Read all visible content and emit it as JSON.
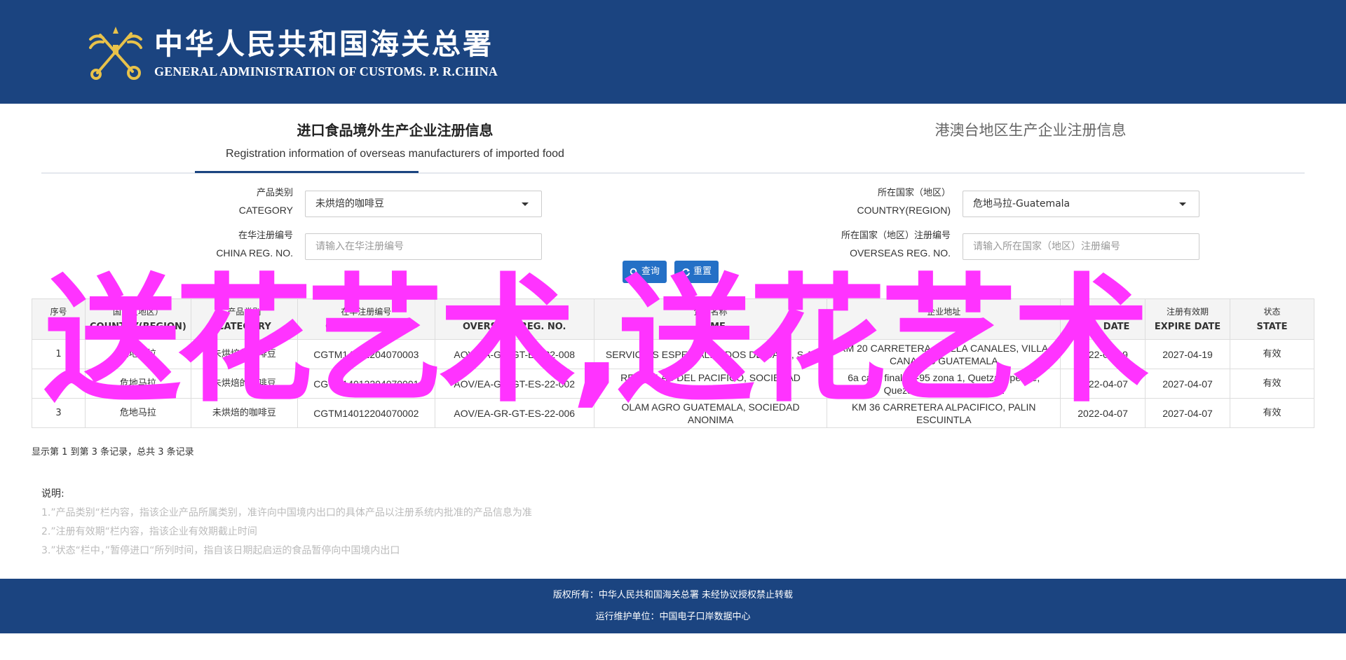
{
  "header": {
    "title_cn": "中华人民共和国海关总署",
    "title_en": "GENERAL ADMINISTRATION OF CUSTOMS. P. R.CHINA"
  },
  "tabs": [
    {
      "label_cn": "进口食品境外生产企业注册信息",
      "label_en": "Registration information of overseas manufacturers of imported food",
      "active": true
    },
    {
      "label_cn": "港澳台地区生产企业注册信息",
      "active": false
    }
  ],
  "form": {
    "category": {
      "label_cn": "产品类别",
      "label_en": "CATEGORY",
      "value": "未烘焙的咖啡豆"
    },
    "country": {
      "label_cn": "所在国家（地区）",
      "label_en": "COUNTRY(REGION)",
      "value": "危地马拉-Guatemala"
    },
    "china_reg": {
      "label_cn": "在华注册编号",
      "label_en": "CHINA REG. NO.",
      "placeholder": "请输入在华注册编号"
    },
    "overseas_reg": {
      "label_cn": "所在国家（地区）注册编号",
      "label_en": "OVERSEAS REG. NO.",
      "placeholder": "请输入所在国家（地区）注册编号"
    },
    "search_label": "查询",
    "reset_label": "重置"
  },
  "table": {
    "columns": [
      {
        "cn": "序号",
        "en": "NO."
      },
      {
        "cn": "国家（地区）",
        "en": "COUNTRY(REGION)"
      },
      {
        "cn": "产品类别",
        "en": "CATEGORY"
      },
      {
        "cn": "在华注册编号",
        "en": "CHINA REG. NO."
      },
      {
        "cn": "所在国家（地区）注册编号",
        "en": "OVERSEAS REG. NO."
      },
      {
        "cn": "企业名称",
        "en": "NAME"
      },
      {
        "cn": "企业地址",
        "en": "ADDRESS"
      },
      {
        "cn": "注册日期",
        "en": "REG. DATE"
      },
      {
        "cn": "注册有效期",
        "en": "EXPIRE DATE"
      },
      {
        "cn": "状态",
        "en": "STATE"
      }
    ],
    "rows": [
      [
        "1",
        "危地马拉",
        "未烘焙的咖啡豆",
        "CGTM14012204070003",
        "AOV/EA-GR-GT-ES-22-008",
        "SERVICIOS ESPECIALIZADOS DE CAFE, S.A.",
        "KM 20 CARRETERA A VILLA CANALES, VILLA CANALES GUATEMALA",
        "2022-04-19",
        "2027-04-19",
        "有效"
      ],
      [
        "2",
        "危地马拉",
        "未烘焙的咖啡豆",
        "CGTM14012204070001",
        "AOV/EA-GR-GT-ES-22-002",
        "RETRILLAS DEL PACIFICO, SOCIEDAD ANONIMA",
        "6a calle final 25-95 zona 1, Quetzaltepeque, Quezaltenango, Guatemala",
        "2022-04-07",
        "2027-04-07",
        "有效"
      ],
      [
        "3",
        "危地马拉",
        "未烘焙的咖啡豆",
        "CGTM14012204070002",
        "AOV/EA-GR-GT-ES-22-006",
        "OLAM AGRO GUATEMALA, SOCIEDAD ANONIMA",
        "KM 36 CARRETERA ALPACIFICO, PALIN ESCUINTLA",
        "2022-04-07",
        "2027-04-07",
        "有效"
      ]
    ]
  },
  "summary": "显示第 1 到第 3 条记录，总共 3 条记录",
  "notes": {
    "title": "说明:",
    "items": [
      "1.”产品类别“栏内容，指该企业产品所属类别，准许向中国境内出口的具体产品以注册系统内批准的产品信息为准",
      "2.”注册有效期“栏内容，指该企业有效期截止时间",
      "3.”状态“栏中，”暂停进口“所列时间，指自该日期起启运的食品暂停向中国境内出口"
    ]
  },
  "watermark": "送花艺术,送花艺术",
  "footer": {
    "line1": "版权所有：中华人民共和国海关总署 未经协议授权禁止转载",
    "line2": "运行维护单位：中国电子口岸数据中心"
  }
}
